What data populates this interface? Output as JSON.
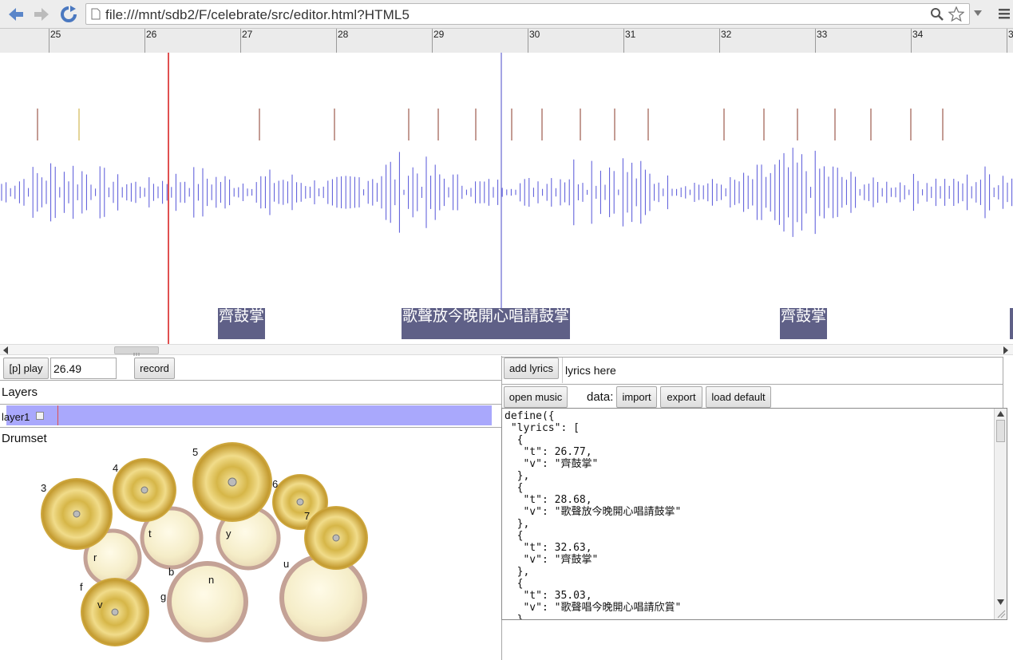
{
  "browser": {
    "url": "file:///mnt/sdb2/F/celebrate/src/editor.html?HTML5"
  },
  "ruler": {
    "ticks": [
      "25",
      "26",
      "27",
      "28",
      "29",
      "30",
      "31",
      "32",
      "33",
      "34",
      "3"
    ]
  },
  "timeline": {
    "lyrics": [
      {
        "text": "齊鼓掌"
      },
      {
        "text": "歌聲放今晚開心唱請鼓掌"
      },
      {
        "text": "齊鼓掌"
      }
    ]
  },
  "controls": {
    "play_label": "[p] play",
    "time_value": "26.49",
    "record_label": "record",
    "layers_title": "Layers",
    "layer_name": "layer1",
    "drumset_title": "Drumset"
  },
  "drumset": {
    "labels": [
      "3",
      "4",
      "5",
      "6",
      "7",
      "t",
      "y",
      "r",
      "b",
      "n",
      "u",
      "g",
      "f",
      "v"
    ]
  },
  "right": {
    "add_lyrics_label": "add lyrics",
    "lyrics_input_value": "lyrics here",
    "open_music_label": "open music",
    "data_label": "data:",
    "import_label": "import",
    "export_label": "export",
    "load_default_label": "load default",
    "code_text": "define({\n \"lyrics\": [\n  {\n   \"t\": 26.77,\n   \"v\": \"齊鼓掌\"\n  },\n  {\n   \"t\": 28.68,\n   \"v\": \"歌聲放今晚開心唱請鼓掌\"\n  },\n  {\n   \"t\": 32.63,\n   \"v\": \"齊鼓掌\"\n  },\n  {\n   \"t\": 35.03,\n   \"v\": \"歌聲唱今晚開心唱請欣賞\"\n  },"
  },
  "colors": {
    "waveform": "#5555d8",
    "playhead": "#e05050",
    "layer": "#a9a8fc",
    "lyric_bg": "#5f6087"
  }
}
